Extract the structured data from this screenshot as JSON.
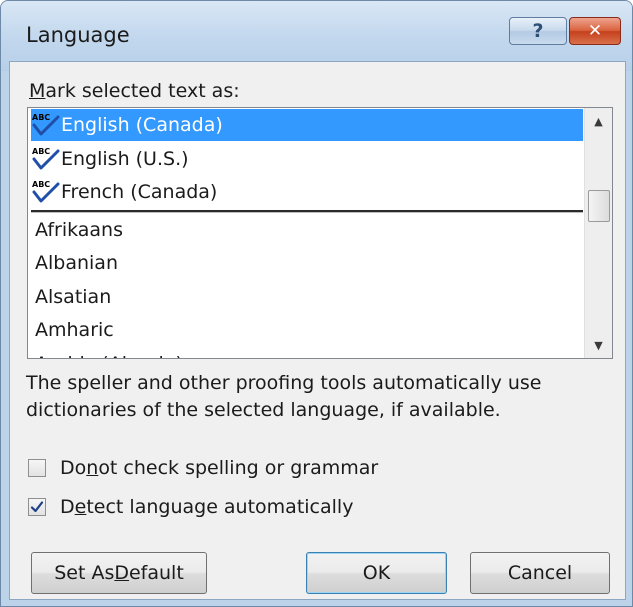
{
  "window": {
    "title": "Language",
    "help_glyph": "?",
    "close_glyph": "✕"
  },
  "mark_label": "Mark selected text as:",
  "languages": [
    {
      "label": "English (Canada)",
      "spellcheck_icon": true,
      "selected": true
    },
    {
      "label": "English (U.S.)",
      "spellcheck_icon": true,
      "selected": false
    },
    {
      "label": "French (Canada)",
      "spellcheck_icon": true,
      "selected": false
    },
    {
      "label": "Afrikaans",
      "spellcheck_icon": false,
      "selected": false
    },
    {
      "label": "Albanian",
      "spellcheck_icon": false,
      "selected": false
    },
    {
      "label": "Alsatian",
      "spellcheck_icon": false,
      "selected": false
    },
    {
      "label": "Amharic",
      "spellcheck_icon": false,
      "selected": false
    },
    {
      "label": "Arabic (Algeria)",
      "spellcheck_icon": false,
      "selected": false
    }
  ],
  "scrollbar": {
    "up_glyph": "▲",
    "down_glyph": "▼"
  },
  "description": "The speller and other proofing tools automatically use dictionaries of the selected language, if available.",
  "options": {
    "no_check": {
      "label": "Do not check spelling or grammar",
      "checked": false
    },
    "detect": {
      "label": "Detect language automatically",
      "checked": true
    }
  },
  "buttons": {
    "set_default": "Set As Default",
    "ok": "OK",
    "cancel": "Cancel"
  },
  "colors": {
    "selection": "#3399ff",
    "spell_check_mark": "#1f4fa8"
  }
}
